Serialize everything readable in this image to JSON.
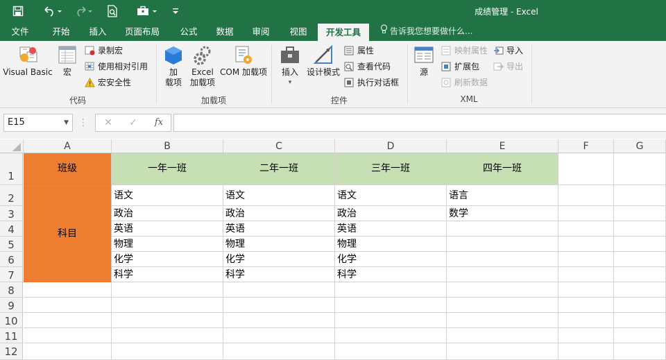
{
  "window": {
    "title": "成绩管理  -  Excel",
    "quick_access": [
      "save-icon",
      "undo-icon",
      "redo-icon",
      "print-preview-icon",
      "toolbox-icon",
      "customize-icon"
    ]
  },
  "tabs": [
    "文件",
    "开始",
    "插入",
    "页面布局",
    "公式",
    "数据",
    "审阅",
    "视图",
    "开发工具"
  ],
  "active_tab": "开发工具",
  "tell_me": "告诉我您想要做什么...",
  "ribbon": {
    "code_group": {
      "label": "代码",
      "visual_basic": "Visual Basic",
      "macros": "宏",
      "record_macro": "录制宏",
      "relative_ref": "使用相对引用",
      "macro_security": "宏安全性"
    },
    "addins_group": {
      "label": "加载项",
      "addins_1": "加",
      "addins_2": "载项",
      "excel_addins_1": "Excel",
      "excel_addins_2": "加载项",
      "com_addins": "COM 加载项"
    },
    "controls_group": {
      "label": "控件",
      "insert": "插入",
      "design_mode": "设计模式",
      "properties": "属性",
      "view_code": "查看代码",
      "run_dialog": "执行对话框"
    },
    "xml_group": {
      "label": "XML",
      "source": "源",
      "map_properties": "映射属性",
      "expansion_packs": "扩展包",
      "refresh_data": "刷新数据",
      "import": "导入",
      "export": "导出"
    }
  },
  "formula_bar": {
    "name_box": "E15",
    "fx": "fx",
    "formula": ""
  },
  "sheet": {
    "columns": [
      "A",
      "B",
      "C",
      "D",
      "E",
      "F",
      "G"
    ],
    "rows": [
      "1",
      "2",
      "3",
      "4",
      "5",
      "6",
      "7",
      "8",
      "9",
      "10",
      "11",
      "12"
    ],
    "header_row": {
      "A": "班级",
      "B": "一年一班",
      "C": "二年一班",
      "D": "三年一班",
      "E": "四年一班"
    },
    "merged_label": "科目",
    "col_B": [
      "语文",
      "政治",
      "英语",
      "物理",
      "化学",
      "科学"
    ],
    "col_C": [
      "语文",
      "政治",
      "英语",
      "物理",
      "化学",
      "科学"
    ],
    "col_D": [
      "语文",
      "政治",
      "英语",
      "物理",
      "化学",
      "科学"
    ],
    "col_E": [
      "语言",
      "数学"
    ],
    "colors": {
      "header_green": "#c6e0b4",
      "label_orange": "#ed7d31",
      "excel_green": "#217346"
    }
  }
}
